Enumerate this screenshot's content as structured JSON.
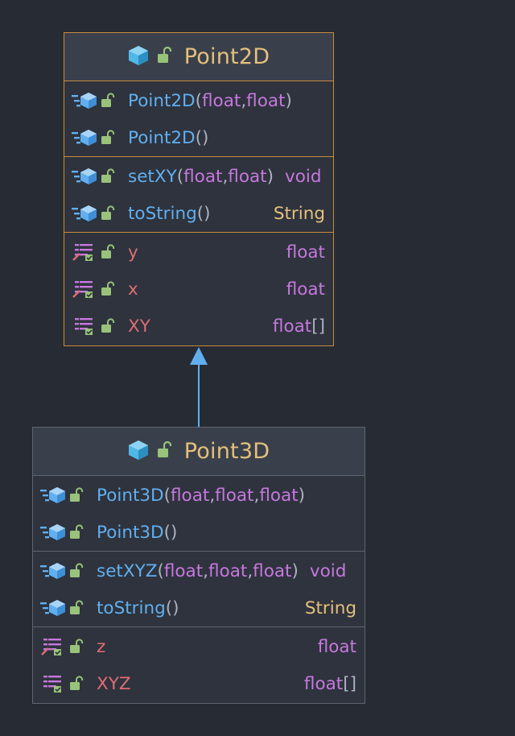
{
  "classes": [
    {
      "name": "Point2D",
      "constructors": [
        {
          "name": "Point2D",
          "params": [
            "float",
            "float"
          ]
        },
        {
          "name": "Point2D",
          "params": []
        }
      ],
      "methods": [
        {
          "name": "setXY",
          "params": [
            "float",
            "float"
          ],
          "returns": "void"
        },
        {
          "name": "toString",
          "params": [],
          "returns": "String"
        }
      ],
      "fields": [
        {
          "name": "y",
          "type": "float"
        },
        {
          "name": "x",
          "type": "float"
        },
        {
          "name": "XY",
          "type": "float",
          "suffix": "[]"
        }
      ]
    },
    {
      "name": "Point3D",
      "constructors": [
        {
          "name": "Point3D",
          "params": [
            "float",
            "float",
            "float"
          ]
        },
        {
          "name": "Point3D",
          "params": []
        }
      ],
      "methods": [
        {
          "name": "setXYZ",
          "params": [
            "float",
            "float",
            "float"
          ],
          "returns": "void"
        },
        {
          "name": "toString",
          "params": [],
          "returns": "String"
        }
      ],
      "fields": [
        {
          "name": "z",
          "type": "float"
        },
        {
          "name": "XYZ",
          "type": "float",
          "suffix": "[]"
        }
      ]
    }
  ],
  "punctuation": {
    "open": "(",
    "close": ")",
    "sep": ", ",
    "empty": "()"
  },
  "colors": {
    "background": "#272b33",
    "header": "#3a404b",
    "selected_border": "#c88a3e",
    "method": "#61afef",
    "field": "#e06c75",
    "type": "#c678dd",
    "class_title": "#e5c07b",
    "arrow": "#61afef"
  }
}
